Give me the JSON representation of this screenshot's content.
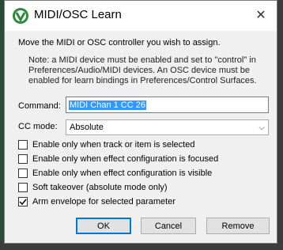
{
  "window": {
    "title": "MIDI/OSC Learn",
    "close_glyph": "✕"
  },
  "instruction": "Move the MIDI or OSC controller you wish to assign.",
  "note": "Note: a MIDI device must be enabled and set to \"control\" in Preferences/Audio/MIDI devices. An OSC device must be enabled for learn bindings in Preferences/Control Surfaces.",
  "command": {
    "label": "Command:",
    "value": "MIDI Chan 1 CC 26"
  },
  "cc_mode": {
    "label": "CC mode:",
    "value": "Absolute"
  },
  "options": [
    {
      "label": "Enable only when track or item is selected",
      "checked": false
    },
    {
      "label": "Enable only when effect configuration is focused",
      "checked": false
    },
    {
      "label": "Enable only when effect configuration is visible",
      "checked": false
    },
    {
      "label": "Soft takeover (absolute mode only)",
      "checked": false
    },
    {
      "label": "Arm envelope for selected parameter",
      "checked": true
    }
  ],
  "buttons": {
    "ok": "OK",
    "cancel": "Cancel",
    "remove": "Remove"
  },
  "colors": {
    "accent": "#0078d7",
    "selection": "#3399ff",
    "icon_green": "#2e8b3e"
  }
}
